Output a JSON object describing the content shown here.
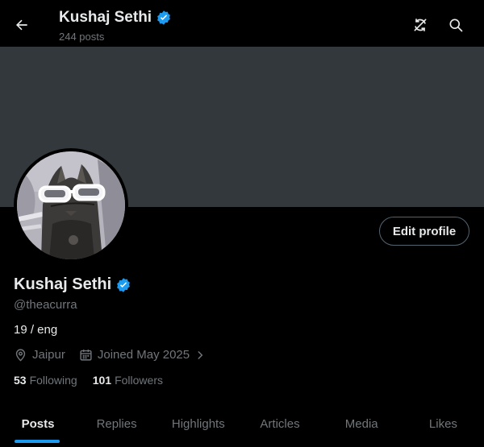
{
  "header": {
    "title": "Kushaj Sethi",
    "post_count": "244 posts",
    "back_icon": "arrow-left-icon",
    "refresh_icon": "refresh-icon",
    "search_icon": "search-icon"
  },
  "profile": {
    "display_name": "Kushaj Sethi",
    "verified": true,
    "handle": "@theacurra",
    "bio": "19 / eng",
    "location": "Jaipur",
    "joined": "Joined May 2025",
    "edit_button": "Edit profile",
    "following_count": "53",
    "following_label": "Following",
    "followers_count": "101",
    "followers_label": "Followers"
  },
  "tabs": [
    {
      "label": "Posts",
      "active": true
    },
    {
      "label": "Replies",
      "active": false
    },
    {
      "label": "Highlights",
      "active": false
    },
    {
      "label": "Articles",
      "active": false
    },
    {
      "label": "Media",
      "active": false
    },
    {
      "label": "Likes",
      "active": false
    }
  ],
  "colors": {
    "background": "#000000",
    "banner": "#33383c",
    "accent": "#1d9bf0",
    "muted_text": "#71767b",
    "primary_text": "#e7e9ea"
  }
}
